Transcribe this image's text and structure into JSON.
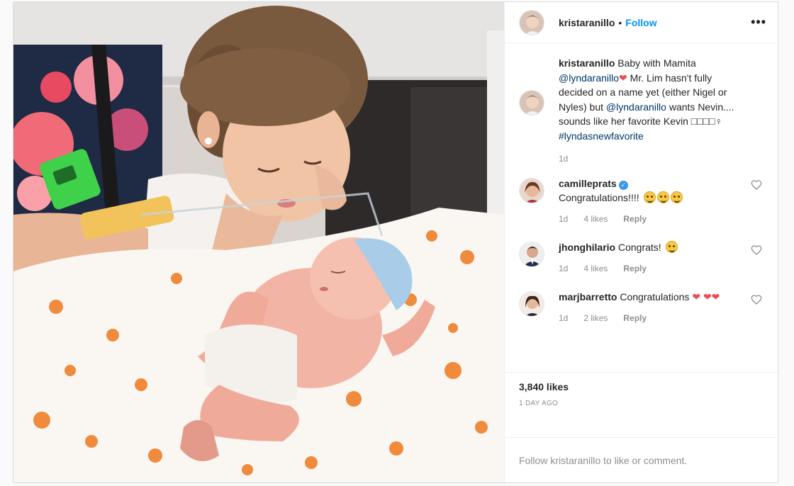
{
  "post": {
    "username": "kristaranillo",
    "separator": "•",
    "follow_label": "Follow",
    "more_label": "•••"
  },
  "caption": {
    "username": "kristaranillo",
    "text_1": "Baby with Mamita",
    "mention_1": "@lyndaranillo",
    "text_2": "Mr. Lim hasn't fully decided on a name yet (either Nigel or Nyles) but",
    "mention_2": "@lyndaranillo",
    "text_3": "wants Nevin.... sounds like her favorite Kevin □□□□♀",
    "hashtag": "#lyndasnewfavorite",
    "time": "1d"
  },
  "comments": [
    {
      "username": "camilleprats",
      "verified": true,
      "text": "Congratulations!!!!",
      "time": "1d",
      "likes": "4 likes",
      "reply": "Reply"
    },
    {
      "username": "jhonghilario",
      "text": "Congrats!",
      "time": "1d",
      "likes": "4 likes",
      "reply": "Reply"
    },
    {
      "username": "marjbarretto",
      "text": "Congratulations",
      "time": "1d",
      "likes": "2 likes",
      "reply": "Reply"
    }
  ],
  "stats": {
    "likes": "3,840 likes",
    "timestamp": "1 DAY AGO"
  },
  "footer": {
    "prompt": "Follow kristaranillo to like or comment."
  },
  "colors": {
    "accent": "#0095f6",
    "link": "#00376b",
    "heart": "#ed4956",
    "muted": "#8e8e8e"
  },
  "icons": [
    "more-options-icon",
    "heart-icon",
    "verified-badge-icon",
    "smiling-face-emoji",
    "red-heart-emoji"
  ]
}
